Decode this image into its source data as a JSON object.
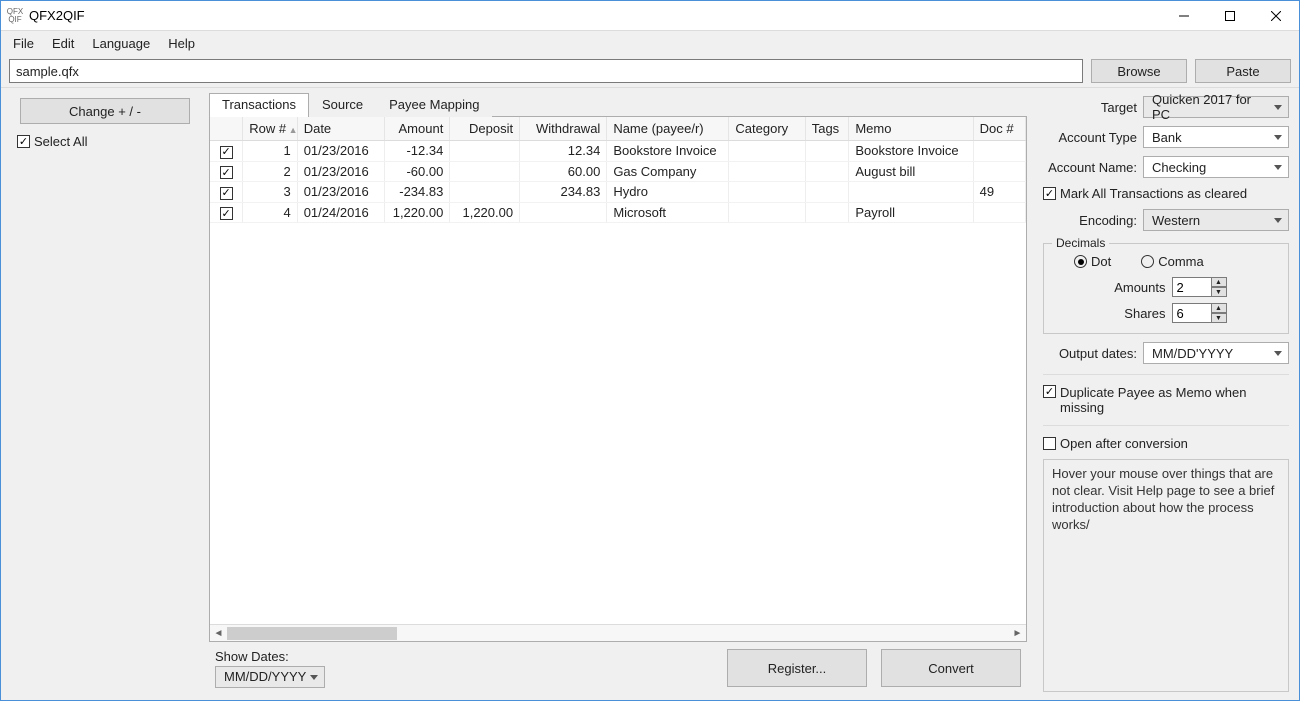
{
  "window": {
    "title": "QFX2QIF"
  },
  "menu": {
    "file": "File",
    "edit": "Edit",
    "language": "Language",
    "help": "Help"
  },
  "file_row": {
    "path": "sample.qfx",
    "browse": "Browse",
    "paste": "Paste"
  },
  "left": {
    "change": "Change + / -",
    "select_all": "Select All"
  },
  "tabs": {
    "transactions": "Transactions",
    "source": "Source",
    "payee_mapping": "Payee Mapping"
  },
  "table": {
    "headers": {
      "row": "Row #",
      "date": "Date",
      "amount": "Amount",
      "deposit": "Deposit",
      "withdrawal": "Withdrawal",
      "name": "Name (payee/r)",
      "category": "Category",
      "tags": "Tags",
      "memo": "Memo",
      "doc": "Doc #"
    },
    "rows": [
      {
        "n": "1",
        "date": "01/23/2016",
        "amount": "-12.34",
        "deposit": "",
        "withdrawal": "12.34",
        "name": "Bookstore Invoice",
        "category": "",
        "tags": "",
        "memo": "Bookstore Invoice",
        "doc": ""
      },
      {
        "n": "2",
        "date": "01/23/2016",
        "amount": "-60.00",
        "deposit": "",
        "withdrawal": "60.00",
        "name": "Gas Company",
        "category": "",
        "tags": "",
        "memo": "August bill",
        "doc": ""
      },
      {
        "n": "3",
        "date": "01/23/2016",
        "amount": "-234.83",
        "deposit": "",
        "withdrawal": "234.83",
        "name": "Hydro",
        "category": "",
        "tags": "",
        "memo": "",
        "doc": "49"
      },
      {
        "n": "4",
        "date": "01/24/2016",
        "amount": "1,220.00",
        "deposit": "1,220.00",
        "withdrawal": "",
        "name": "Microsoft",
        "category": "",
        "tags": "",
        "memo": "Payroll",
        "doc": ""
      }
    ]
  },
  "bottom": {
    "show_dates_label": "Show Dates:",
    "show_dates_value": "MM/DD/YYYY",
    "register": "Register...",
    "convert": "Convert"
  },
  "right": {
    "target_label": "Target",
    "target_value": "Quicken 2017 for PC",
    "account_type_label": "Account Type",
    "account_type_value": "Bank",
    "account_name_label": "Account Name:",
    "account_name_value": "Checking",
    "mark_cleared": "Mark All Transactions as cleared",
    "encoding_label": "Encoding:",
    "encoding_value": "Western",
    "decimals_legend": "Decimals",
    "dot": "Dot",
    "comma": "Comma",
    "amounts_label": "Amounts",
    "amounts_value": "2",
    "shares_label": "Shares",
    "shares_value": "6",
    "output_dates_label": "Output dates:",
    "output_dates_value": "MM/DD'YYYY",
    "dup_payee": "Duplicate Payee as Memo when missing",
    "open_after": "Open after conversion",
    "hint": "Hover your mouse over things that are not clear. Visit Help page to see a brief introduction about how the process works/"
  }
}
